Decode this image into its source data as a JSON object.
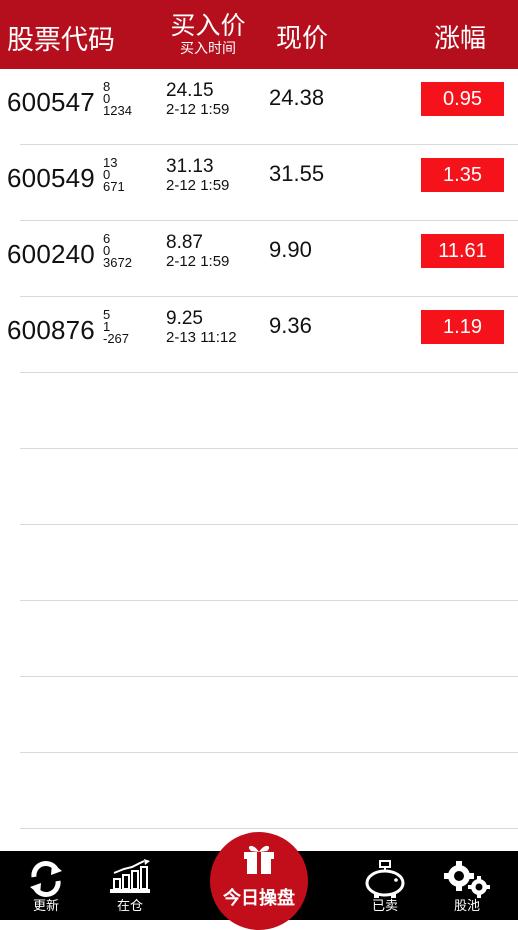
{
  "header": {
    "code_label": "股票代码",
    "buy_price_label": "买入价",
    "buy_time_label": "买入时间",
    "current_label": "现价",
    "change_label": "涨幅"
  },
  "rows": [
    {
      "code": "600547",
      "n1": "8",
      "n2": "0",
      "n3": "1234",
      "buy_price": "24.15",
      "buy_time": "2-12 1:59",
      "current": "24.38",
      "change": "0.95"
    },
    {
      "code": "600549",
      "n1": "13",
      "n2": "0",
      "n3": "671",
      "buy_price": "31.13",
      "buy_time": "2-12 1:59",
      "current": "31.55",
      "change": "1.35"
    },
    {
      "code": "600240",
      "n1": "6",
      "n2": "0",
      "n3": "3672",
      "buy_price": "8.87",
      "buy_time": "2-12 1:59",
      "current": "9.90",
      "change": "11.61"
    },
    {
      "code": "600876",
      "n1": "5",
      "n2": "1",
      "n3": "-267",
      "buy_price": "9.25",
      "buy_time": "2-13 11:12",
      "current": "9.36",
      "change": "1.19"
    }
  ],
  "tabs": {
    "refresh": "更新",
    "holding": "在仓",
    "today": "今日操盘",
    "sold": "已卖",
    "pool": "股池"
  },
  "colors": {
    "header_bg": "#b50f1d",
    "change_badge": "#f5121b",
    "tabbar_bg": "#000000"
  }
}
